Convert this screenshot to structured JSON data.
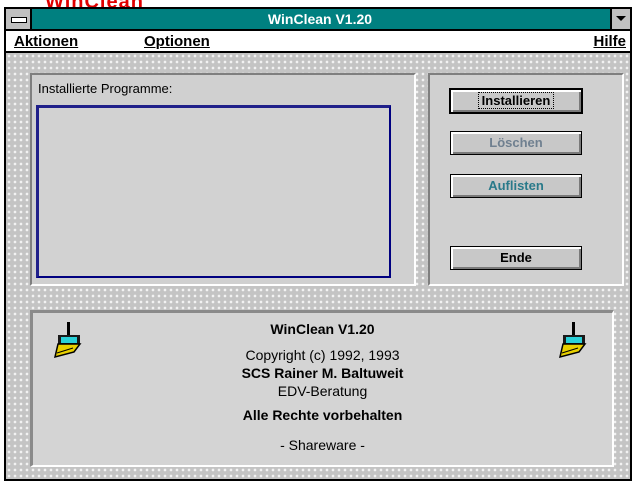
{
  "caption": "WinClean",
  "window": {
    "title": "WinClean V1.20"
  },
  "menu": {
    "aktionen": "Aktionen",
    "optionen": "Optionen",
    "hilfe": "Hilfe"
  },
  "programs": {
    "label": "Installierte Programme:",
    "items": []
  },
  "buttons": {
    "install": "Installieren",
    "delete": "Löschen",
    "list": "Auflisten",
    "end": "Ende"
  },
  "info": {
    "app": "WinClean V1.20",
    "copyright": "Copyright (c) 1992, 1993",
    "company": "SCS Rainer M. Baltuweit",
    "department": "EDV-Beratung",
    "rights": "Alle Rechte vorbehalten",
    "license": "- Shareware -"
  },
  "icons": {
    "left": "broom-icon",
    "right": "broom-icon"
  },
  "colors": {
    "titlebar": "#008080",
    "caption": "#e00000",
    "disabled_text": "#708090",
    "list_border": "#000080"
  }
}
